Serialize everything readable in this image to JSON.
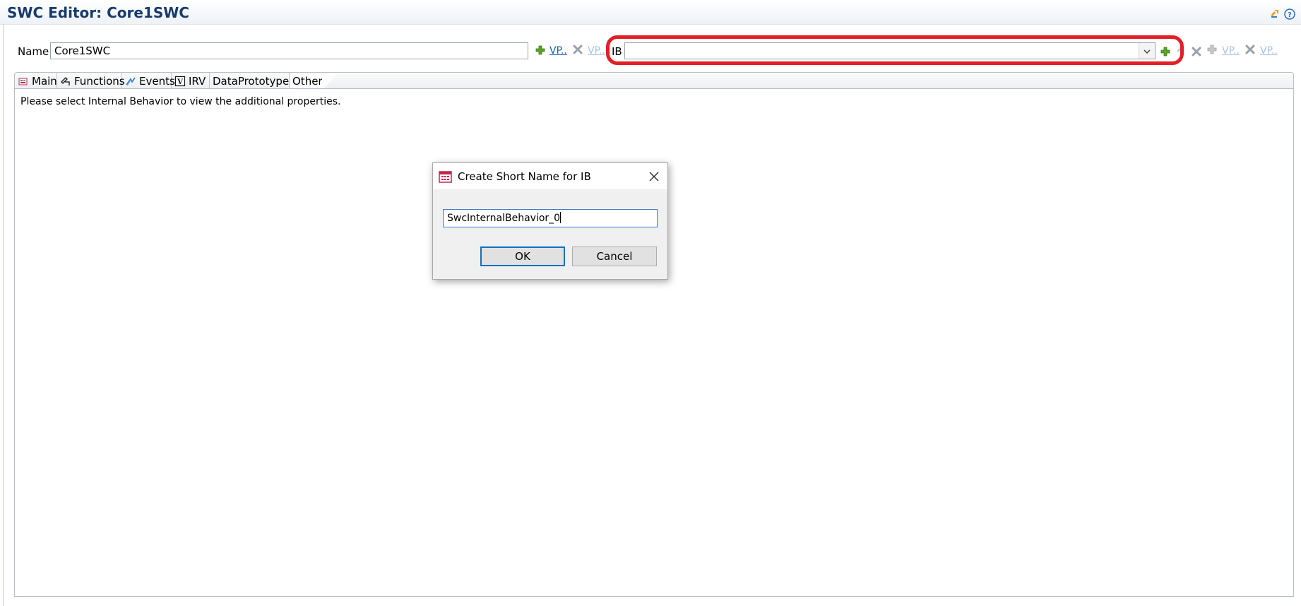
{
  "editor": {
    "title": "SWC Editor: Core1SWC"
  },
  "name_row": {
    "label": "Name",
    "value": "Core1SWC",
    "vp_link": "VP..",
    "vp_link_disabled": "VP.."
  },
  "ib_row": {
    "label": "IB",
    "selected": "",
    "vp_link_disabled_1": "VP..",
    "vp_link_disabled_2": "VP.."
  },
  "tabs": [
    {
      "label": "Main",
      "icon": "main-tab-icon"
    },
    {
      "label": "Functions",
      "icon": "functions-tab-icon"
    },
    {
      "label": "Events",
      "icon": "events-tab-icon"
    },
    {
      "label": "IRV",
      "icon": "irv-tab-icon"
    },
    {
      "label": "DataPrototypes",
      "icon": ""
    },
    {
      "label": "Others",
      "icon": ""
    }
  ],
  "content": {
    "message": "Please select Internal Behavior to view the additional properties."
  },
  "dialog": {
    "title": "Create Short Name for IB",
    "input_value": "SwcInternalBehavior_0",
    "ok_label": "OK",
    "cancel_label": "Cancel"
  },
  "colors": {
    "title_text": "#173b6e",
    "highlight": "#e21f26",
    "link": "#1a5fb4",
    "link_disabled": "#a9c3e6",
    "add_icon": "#5aa42a"
  }
}
